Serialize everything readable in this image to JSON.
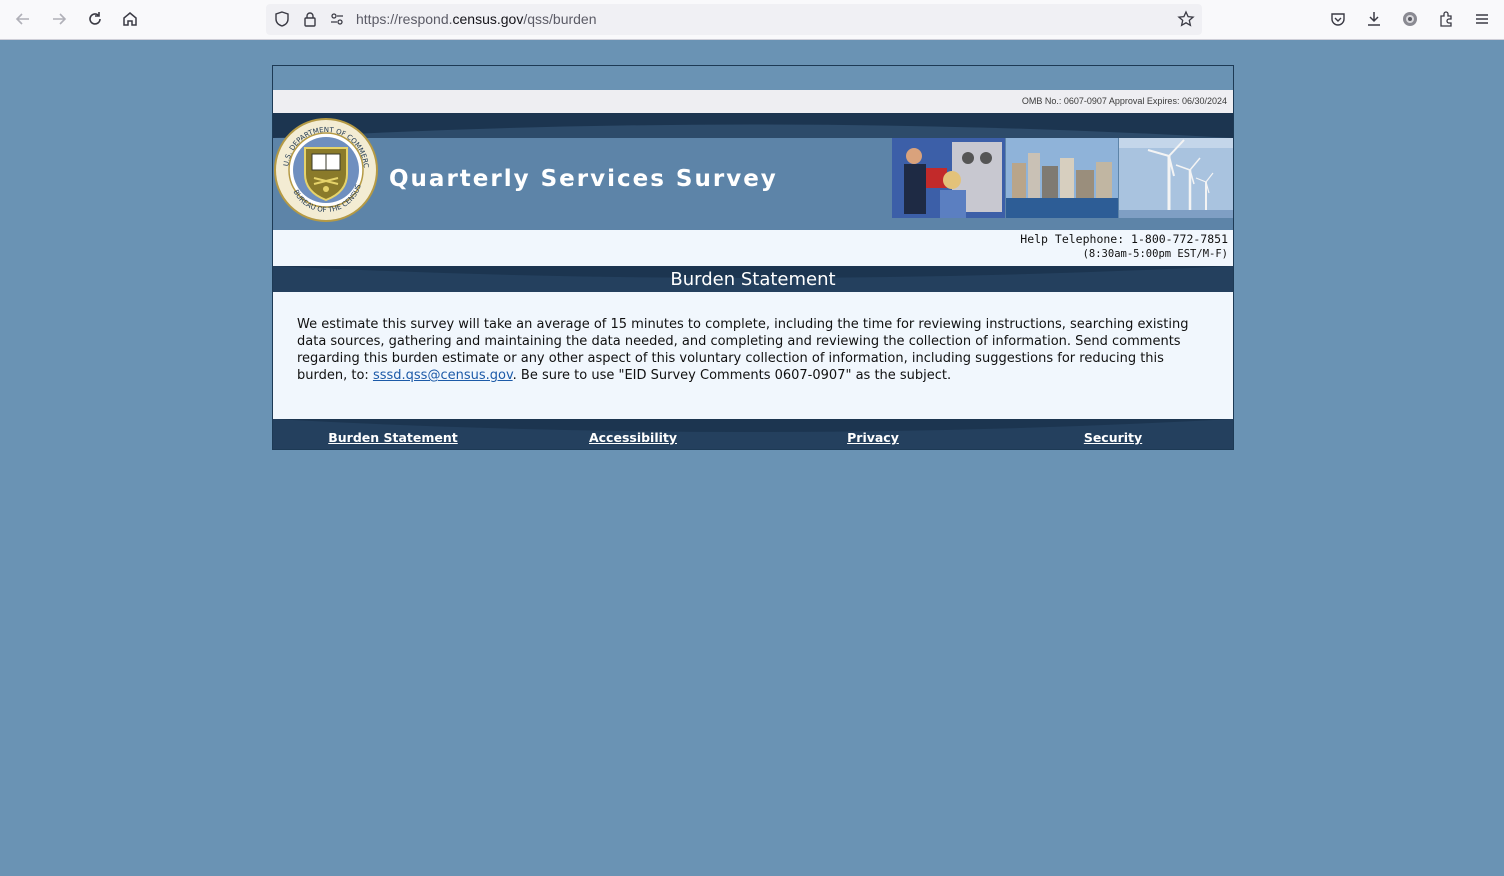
{
  "browser": {
    "url_prefix": "https://respond.",
    "url_domain": "census.gov",
    "url_path": "/qss/burden"
  },
  "header": {
    "omb_text": "OMB No.: 0607-0907 Approval Expires: 06/30/2024",
    "survey_title": "Quarterly Services Survey",
    "seal_text_top": "U.S. DEPARTMENT OF COMMERCE",
    "seal_text_bottom": "BUREAU OF THE CENSUS",
    "help_telephone": "Help Telephone: 1-800-772-7851",
    "help_hours": "(8:30am-5:00pm EST/M-F)"
  },
  "page": {
    "heading": "Burden Statement",
    "body_text": "We estimate this survey will take an average of 15 minutes to complete, including the time for reviewing instructions, searching existing data sources, gathering and maintaining the data needed, and completing and reviewing the collection of information. Send comments regarding this burden estimate or any other aspect of this voluntary collection of information, including suggestions for reducing this burden, to: ",
    "email_link": "sssd.qss@census.gov",
    "body_text_end": ". Be sure to use \"EID Survey Comments 0607-0907\" as the subject."
  },
  "footer": {
    "links": [
      {
        "label": "Burden Statement"
      },
      {
        "label": "Accessibility"
      },
      {
        "label": "Privacy"
      },
      {
        "label": "Security"
      }
    ]
  },
  "colors": {
    "page_bg": "#6a93b4",
    "dark_band": "#1c3550",
    "banner": "#5d84a8",
    "content_bg": "#f1f7fd",
    "link": "#1c5aa8"
  }
}
